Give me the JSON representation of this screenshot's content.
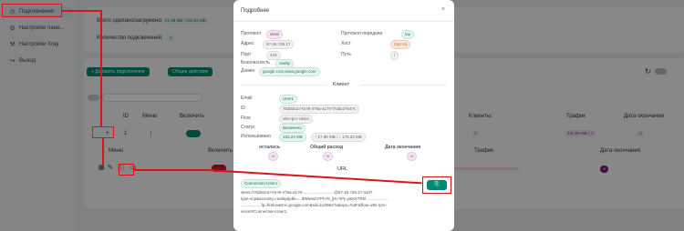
{
  "sidebar": {
    "items": [
      {
        "label": "Подключения",
        "icon": "connections-icon"
      },
      {
        "label": "Настройки пане...",
        "icon": "gear-icon"
      },
      {
        "label": "Настройки Xray",
        "icon": "tool-icon"
      },
      {
        "label": "Выход",
        "icon": "logout-icon"
      }
    ]
  },
  "stats": {
    "upload_download_label": "Всего сделано/загружено:",
    "upload_download_value": "21.98 MB / 483.81 MB",
    "connections_label": "Количество подключений:",
    "connections_value": "1"
  },
  "toolbar": {
    "add_button": "+ Добавить подключение",
    "common_actions_button": "Общие действия"
  },
  "table": {
    "headers": [
      "ID",
      "Меню",
      "Включить",
      "Клиенты:",
      "Трафик",
      "Дата окончания"
    ],
    "row": {
      "id": "1",
      "menu": "⋮",
      "clients": "1",
      "traffic": "482.89 MB / ∞",
      "expiry": "∞"
    },
    "sub_headers": [
      "Меню",
      "Включить",
      "Трафик",
      "Дата окончания"
    ],
    "sub_row_expiry": "∞"
  },
  "modal": {
    "title": "Подробнее",
    "close": "×",
    "protocol_label": "Протокол",
    "protocol_value": "vless",
    "address_label": "Адрес",
    "address_value": "5?.46.?28.1?",
    "port_label": "Порт",
    "port_value": "443",
    "security_label": "Безопасность",
    "security_value": "reality",
    "domain_label": "Домен",
    "domain_value": "google.com,www.google.com",
    "transport_label": "Протокол передачи",
    "transport_value": "tcp",
    "host_label": "Хост",
    "host_value": "(пусто)",
    "path_label": "Путь",
    "path_value": "/",
    "client_section": "Клиент",
    "email_label": "Email",
    "email_value": "User1",
    "id_label": "ID",
    "id_value": "?53bdca?-fa?8-4?6a-a1?0-f?abcd?64?c",
    "flow_label": "Flow",
    "flow_value": "xtls-rprx-vision",
    "status_label": "Статус",
    "status_value": "Включено",
    "used_label": "Использовано",
    "used_value": "183.23 MB",
    "used_detail": "↑ 17.90 MB / ↓ 170.33 MB",
    "col_remaining": "осталось",
    "col_total": "Общий расход",
    "col_expiry": "Дата окончания",
    "remaining_value": "∞",
    "total_value": "∞",
    "expiry_value": "∞",
    "url_section": "URL",
    "url_tag": "Connection-User1",
    "url_lines": [
      "vless://?53bdca?-fa?8-4?6a-a1?0-...........................@5?.46.?28.1?:443?",
      "type=tcp&security=reality&pbk=...lEMwwCFPh?8_jHc?iPj=yi6sXTRhl...................",
      "..................fp=firefox&sni=google.com&sid=bc055e?a&spx=%2F&flow=xtls-rprx-",
      "vision#Connection-User1"
    ],
    "copy_icon": "copy-icon"
  },
  "colors": {
    "accent": "#008771",
    "annotation": "#d8141a"
  }
}
